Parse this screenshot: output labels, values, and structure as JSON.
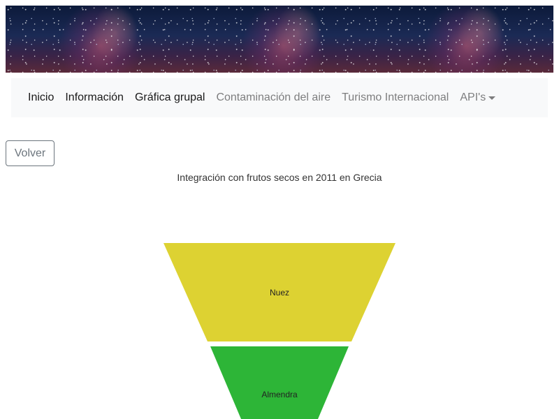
{
  "banner": {
    "image": "milky-way-night-sky"
  },
  "navbar": {
    "items": [
      {
        "label": "Inicio"
      },
      {
        "label": "Información"
      },
      {
        "label": "Gráfica grupal"
      },
      {
        "label": "Contaminación del aire"
      },
      {
        "label": "Turismo Internacional"
      },
      {
        "label": "API's"
      }
    ],
    "dropdown_icon": "caret-down-icon"
  },
  "back_button": {
    "label": "Volver"
  },
  "chart_data": {
    "type": "funnel",
    "title": "Integración con frutos secos en 2011 en Grecia",
    "categories": [
      "Nuez",
      "Almendra"
    ],
    "colors": [
      "#ddd232",
      "#2db537"
    ]
  }
}
